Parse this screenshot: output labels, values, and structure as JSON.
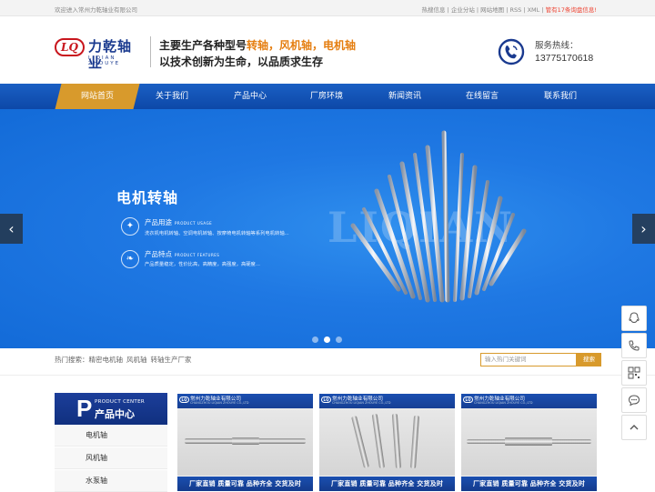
{
  "topbar": {
    "welcome": "欢迎进入常州力乾轴业有限公司",
    "links": "热搜信息 | 企业分站 | 网站地图 | RSS | XML |",
    "notice": "管有17条询盘信息!"
  },
  "header": {
    "logo_mark": "LQ",
    "logo_cn": "力乾轴业",
    "logo_en": "LIQIAN ZHOUYE",
    "slogan1_prefix": "主要生产各种型号",
    "slogan1_highlight": "转轴，风机轴，电机轴",
    "slogan2": "以技术创新为生命，以品质求生存",
    "hotline_label": "服务热线：",
    "hotline_number": "13775170618"
  },
  "nav": {
    "items": [
      "网站首页",
      "关于我们",
      "产品中心",
      "厂房环境",
      "新闻资讯",
      "在线留言",
      "联系我们"
    ]
  },
  "banner": {
    "title": "电机转轴",
    "feature1_title": "产品用途",
    "feature1_en": "PRODUCT USAGE",
    "feature1_desc": "洗衣机电机转轴、空调电机转轴、按摩椅电机转轴等系列电机转轴...",
    "feature2_title": "产品特点",
    "feature2_en": "PRODUCT FEATURES",
    "feature2_desc": "产品质量稳定，性价比高，高精度，高强度，高硬度...",
    "watermark": "LIQIAN",
    "prev": "‹",
    "next": "›"
  },
  "search": {
    "hot_label": "热门搜索：",
    "keywords": [
      "精密电机轴",
      "风机轴",
      "转轴生产厂家"
    ],
    "placeholder": "输入热门关键词",
    "button": "搜索"
  },
  "categories": {
    "header_letter": "P",
    "header_en": "PRODUCT CENTER",
    "header_cn": "产品中心",
    "items": [
      "电机轴",
      "风机轴",
      "水泵轴"
    ]
  },
  "products": [
    {
      "company": "常州力乾轴业有限公司",
      "sub": "CHANGZHOU LIQIAN ZHOUYE CO.,LTD",
      "tagline": "厂家直销  质量可靠  品种齐全  交货及时"
    },
    {
      "company": "常州力乾轴业有限公司",
      "sub": "CHANGZHOU LIQIAN ZHOUYE CO.,LTD",
      "tagline": "厂家直销  质量可靠  品种齐全  交货及时"
    },
    {
      "company": "常州力乾轴业有限公司",
      "sub": "CHANGZHOU LIQIAN ZHOUYE CO.,LTD",
      "tagline": "厂家直销  质量可靠  品种齐全  交货及时"
    }
  ],
  "float_tools": [
    "qq-icon",
    "phone-icon",
    "qrcode-icon",
    "message-icon",
    "back-to-top-icon"
  ],
  "colors": {
    "primary": "#0d48a8",
    "accent": "#d89a2c",
    "highlight": "#e57e10",
    "banner": "#1f78e3"
  }
}
